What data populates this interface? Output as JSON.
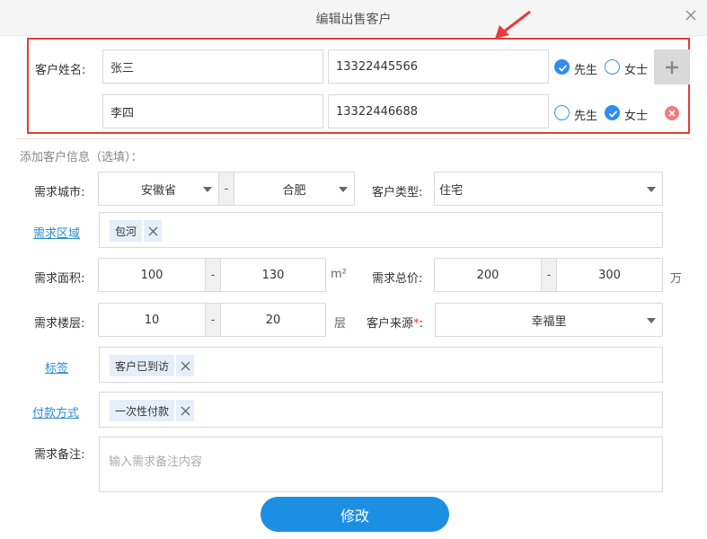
{
  "dialog": {
    "title": "编辑出售客户"
  },
  "customer_name": {
    "label": "客户姓名:",
    "rows": [
      {
        "name": "张三",
        "phone": "13322445566",
        "gender_options": [
          "先生",
          "女士"
        ],
        "selected": "先生"
      },
      {
        "name": "李四",
        "phone": "13322446688",
        "gender_options": [
          "先生",
          "女士"
        ],
        "selected": "女士"
      }
    ]
  },
  "extra": {
    "header": "添加客户信息（选填）：",
    "city": {
      "label": "需求城市:",
      "province": "安徽省",
      "city": "合肥",
      "sep": "-"
    },
    "customer_type": {
      "label": "客户类型:",
      "value": "住宅"
    },
    "region": {
      "label": "需求区域",
      "tags": [
        "包河"
      ]
    },
    "area": {
      "label": "需求面积:",
      "min": "100",
      "sep": "-",
      "max": "130",
      "unit": "m²"
    },
    "total_price": {
      "label": "需求总价:",
      "min": "200",
      "sep": "-",
      "max": "300",
      "unit": "万"
    },
    "floor": {
      "label": "需求楼层:",
      "min": "10",
      "sep": "-",
      "max": "20",
      "unit": "层"
    },
    "source": {
      "label": "客户来源",
      "required_mark": "*",
      "colon": ":",
      "value": "幸福里"
    },
    "tags": {
      "label": "标签",
      "tags": [
        "客户已到访"
      ]
    },
    "payment": {
      "label": "付款方式",
      "tags": [
        "一次性付款"
      ]
    },
    "note": {
      "label": "需求备注:",
      "placeholder": "输入需求备注内容"
    }
  },
  "submit_label": "修改",
  "colors": {
    "accent": "#1c8fe3",
    "highlight_box": "#e53b3b",
    "delete": "#f07b7b"
  }
}
